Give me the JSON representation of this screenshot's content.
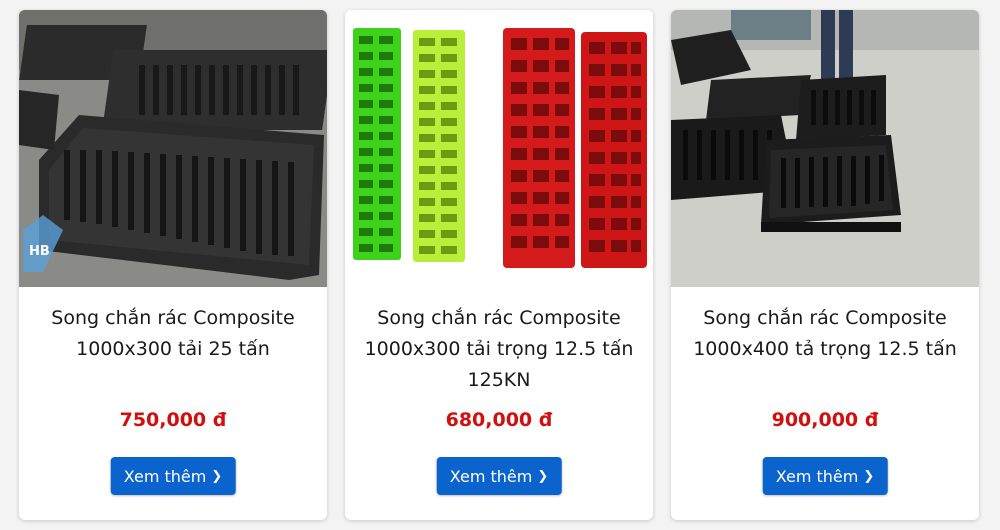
{
  "products": [
    {
      "title_line1": "Song chắn rác Composite",
      "title_line2": "1000x300 tải 25 tấn",
      "title_line3": "",
      "price": "750,000 đ",
      "button_label": "Xem thêm",
      "image": "black-composite-grates"
    },
    {
      "title_line1": "Song chắn rác Composite",
      "title_line2": "1000x300 tải trọng 12.5 tấn",
      "title_line3": "125KN",
      "price": "680,000 đ",
      "button_label": "Xem thêm",
      "image": "green-yellow-red-grates"
    },
    {
      "title_line1": "Song chắn rác Composite",
      "title_line2": "1000x400 tả trọng 12.5 tấn",
      "title_line3": "",
      "price": "900,000 đ",
      "button_label": "Xem thêm",
      "image": "stacked-black-grates"
    }
  ],
  "colors": {
    "price": "#d10f0f",
    "button": "#0b63ce",
    "card_bg": "#ffffff",
    "page_bg": "#f3f3f3"
  },
  "icons": {
    "button_icon": "chevron-right-icon"
  }
}
